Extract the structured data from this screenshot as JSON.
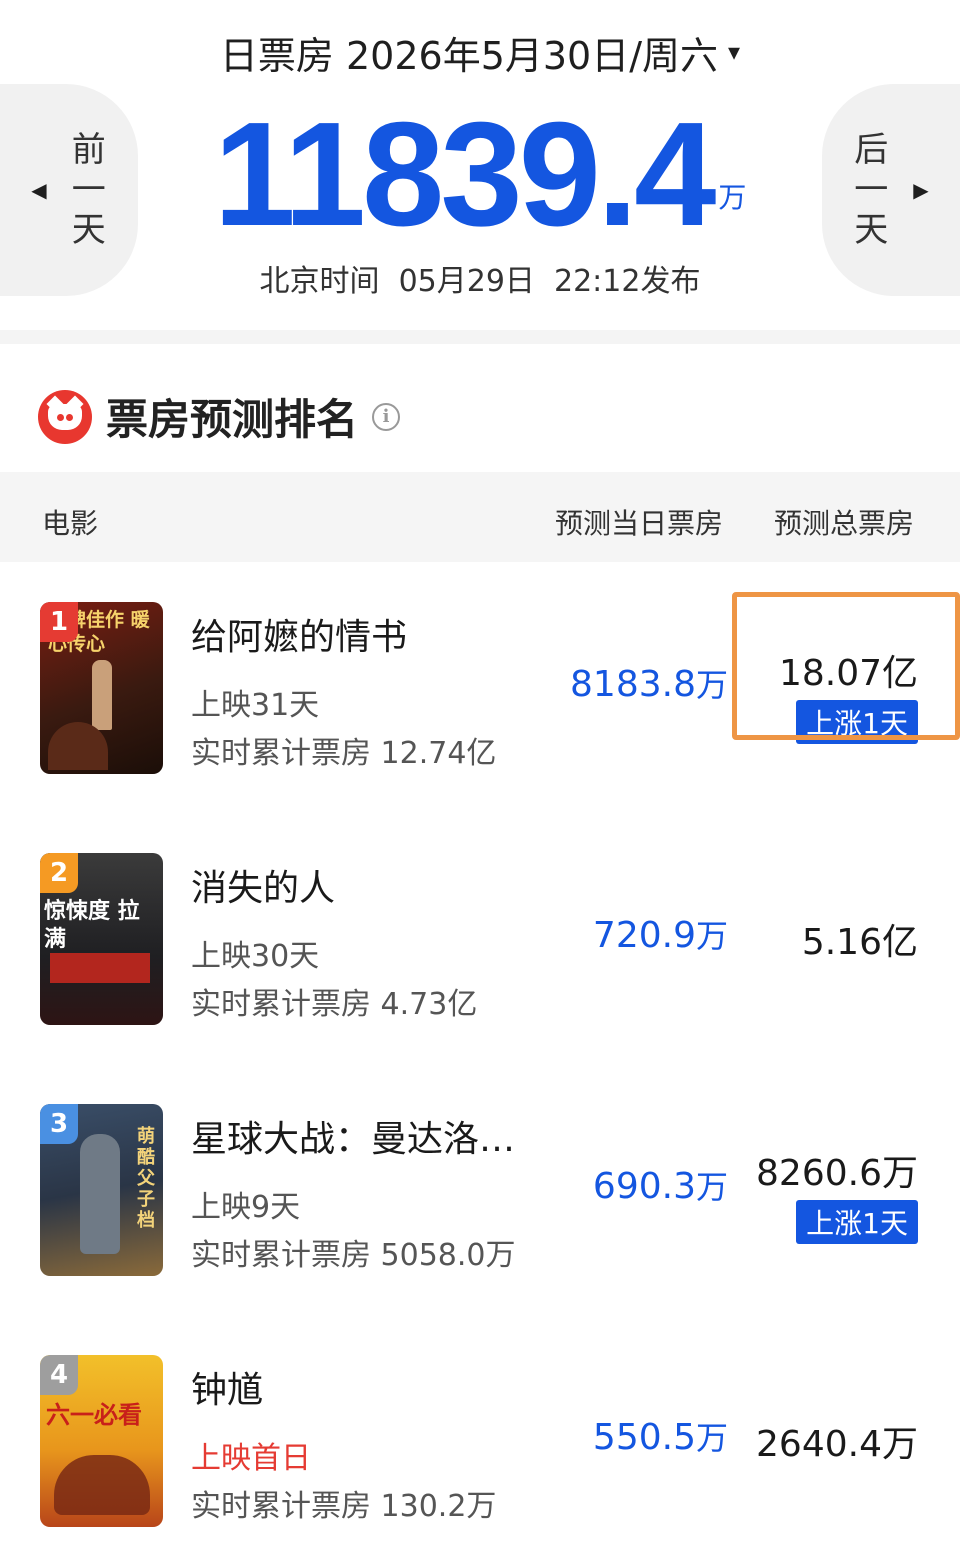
{
  "header": {
    "date_label": "日票房 2026年5月30日/周六",
    "caret": "▾",
    "prev_label": [
      "前",
      "一",
      "天"
    ],
    "next_label": [
      "后",
      "一",
      "天"
    ],
    "prev_arrow": "◀",
    "next_arrow": "▶",
    "total_value": "11839.4",
    "total_unit": "万",
    "publish_text": "北京时间  05月29日  22:12发布"
  },
  "section": {
    "title": "票房预测排名",
    "info_icon": "i"
  },
  "columns": {
    "movie": "电影",
    "day_forecast": "预测当日票房",
    "total_forecast": "预测总票房"
  },
  "colors": {
    "accent_blue": "#1456e0",
    "highlight_orange": "#ee9545",
    "first_day_red": "#e53b33",
    "rank1": "#e53b33",
    "rank2": "#f59a23",
    "rank3": "#4a90e2",
    "rank4": "#9e9e9e"
  },
  "movies": [
    {
      "rank": "1",
      "title": "给阿嬷的情书",
      "days": "上映31天",
      "cumulative": "实时累计票房 12.74亿",
      "day_value": "8183.8",
      "day_unit": "万",
      "total_value": "18.07亿",
      "badge": "上涨1天",
      "poster_text": "口碑佳作 暖心传心"
    },
    {
      "rank": "2",
      "title": "消失的人",
      "days": "上映30天",
      "cumulative": "实时累计票房 4.73亿",
      "day_value": "720.9",
      "day_unit": "万",
      "total_value": "5.16亿",
      "poster_text": "惊悚度 拉满"
    },
    {
      "rank": "3",
      "title": "星球大战：曼达洛…",
      "days": "上映9天",
      "cumulative": "实时累计票房 5058.0万",
      "day_value": "690.3",
      "day_unit": "万",
      "total_value": "8260.6万",
      "badge": "上涨1天",
      "poster_text": "萌酷父子档"
    },
    {
      "rank": "4",
      "title": "钟馗",
      "days": "上映首日",
      "cumulative": "实时累计票房 130.2万",
      "day_value": "550.5",
      "day_unit": "万",
      "total_value": "2640.4万",
      "poster_text": "六一必看"
    }
  ]
}
